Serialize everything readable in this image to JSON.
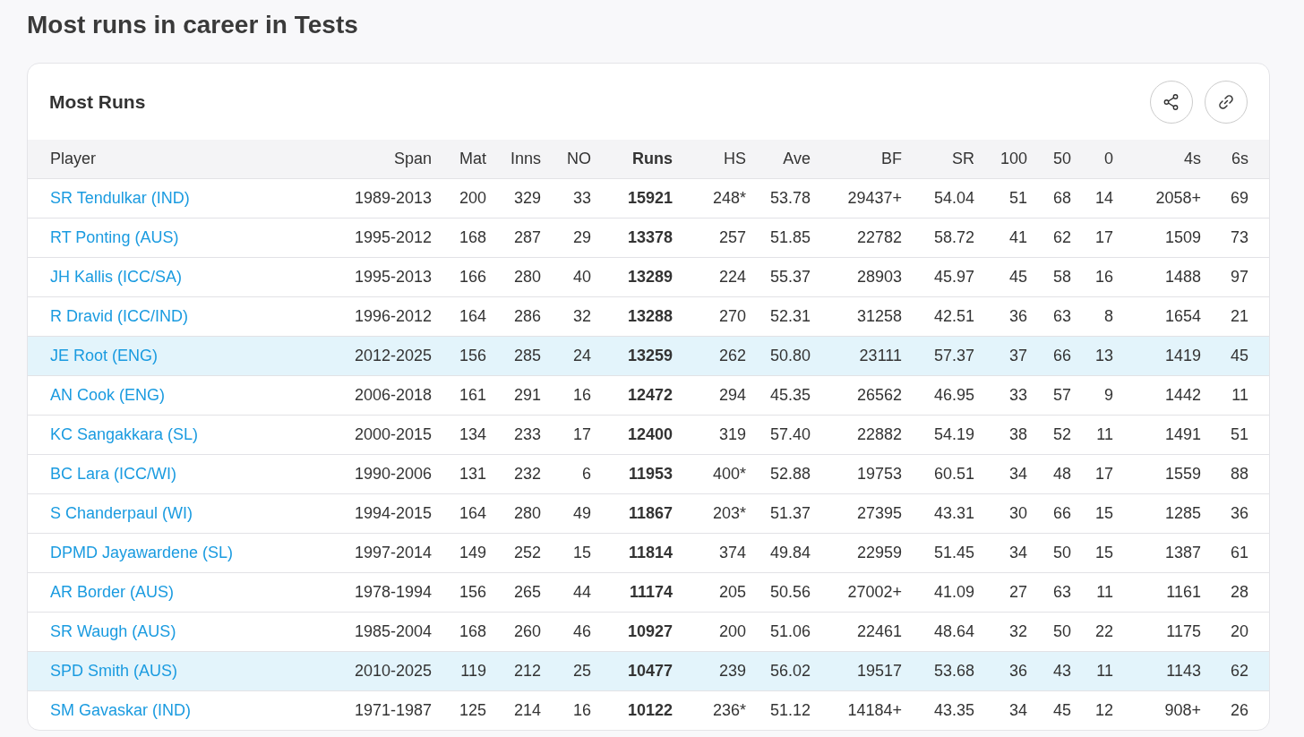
{
  "page_title": "Most runs in career in Tests",
  "card": {
    "title": "Most Runs"
  },
  "table": {
    "columns": [
      "Player",
      "Span",
      "Mat",
      "Inns",
      "NO",
      "Runs",
      "HS",
      "Ave",
      "BF",
      "SR",
      "100",
      "50",
      "0",
      "4s",
      "6s"
    ],
    "rows": [
      {
        "player": "SR Tendulkar (IND)",
        "highlighted": false,
        "values": [
          "1989-2013",
          "200",
          "329",
          "33",
          "15921",
          "248*",
          "53.78",
          "29437+",
          "54.04",
          "51",
          "68",
          "14",
          "2058+",
          "69"
        ]
      },
      {
        "player": "RT Ponting (AUS)",
        "highlighted": false,
        "values": [
          "1995-2012",
          "168",
          "287",
          "29",
          "13378",
          "257",
          "51.85",
          "22782",
          "58.72",
          "41",
          "62",
          "17",
          "1509",
          "73"
        ]
      },
      {
        "player": "JH Kallis (ICC/SA)",
        "highlighted": false,
        "values": [
          "1995-2013",
          "166",
          "280",
          "40",
          "13289",
          "224",
          "55.37",
          "28903",
          "45.97",
          "45",
          "58",
          "16",
          "1488",
          "97"
        ]
      },
      {
        "player": "R Dravid (ICC/IND)",
        "highlighted": false,
        "values": [
          "1996-2012",
          "164",
          "286",
          "32",
          "13288",
          "270",
          "52.31",
          "31258",
          "42.51",
          "36",
          "63",
          "8",
          "1654",
          "21"
        ]
      },
      {
        "player": "JE Root (ENG)",
        "highlighted": true,
        "values": [
          "2012-2025",
          "156",
          "285",
          "24",
          "13259",
          "262",
          "50.80",
          "23111",
          "57.37",
          "37",
          "66",
          "13",
          "1419",
          "45"
        ]
      },
      {
        "player": "AN Cook (ENG)",
        "highlighted": false,
        "values": [
          "2006-2018",
          "161",
          "291",
          "16",
          "12472",
          "294",
          "45.35",
          "26562",
          "46.95",
          "33",
          "57",
          "9",
          "1442",
          "11"
        ]
      },
      {
        "player": "KC Sangakkara (SL)",
        "highlighted": false,
        "values": [
          "2000-2015",
          "134",
          "233",
          "17",
          "12400",
          "319",
          "57.40",
          "22882",
          "54.19",
          "38",
          "52",
          "11",
          "1491",
          "51"
        ]
      },
      {
        "player": "BC Lara (ICC/WI)",
        "highlighted": false,
        "values": [
          "1990-2006",
          "131",
          "232",
          "6",
          "11953",
          "400*",
          "52.88",
          "19753",
          "60.51",
          "34",
          "48",
          "17",
          "1559",
          "88"
        ]
      },
      {
        "player": "S Chanderpaul (WI)",
        "highlighted": false,
        "values": [
          "1994-2015",
          "164",
          "280",
          "49",
          "11867",
          "203*",
          "51.37",
          "27395",
          "43.31",
          "30",
          "66",
          "15",
          "1285",
          "36"
        ]
      },
      {
        "player": "DPMD Jayawardene (SL)",
        "highlighted": false,
        "values": [
          "1997-2014",
          "149",
          "252",
          "15",
          "11814",
          "374",
          "49.84",
          "22959",
          "51.45",
          "34",
          "50",
          "15",
          "1387",
          "61"
        ]
      },
      {
        "player": "AR Border (AUS)",
        "highlighted": false,
        "values": [
          "1978-1994",
          "156",
          "265",
          "44",
          "11174",
          "205",
          "50.56",
          "27002+",
          "41.09",
          "27",
          "63",
          "11",
          "1161",
          "28"
        ]
      },
      {
        "player": "SR Waugh (AUS)",
        "highlighted": false,
        "values": [
          "1985-2004",
          "168",
          "260",
          "46",
          "10927",
          "200",
          "51.06",
          "22461",
          "48.64",
          "32",
          "50",
          "22",
          "1175",
          "20"
        ]
      },
      {
        "player": "SPD Smith (AUS)",
        "highlighted": true,
        "values": [
          "2010-2025",
          "119",
          "212",
          "25",
          "10477",
          "239",
          "56.02",
          "19517",
          "53.68",
          "36",
          "43",
          "11",
          "1143",
          "62"
        ]
      },
      {
        "player": "SM Gavaskar (IND)",
        "highlighted": false,
        "values": [
          "1971-1987",
          "125",
          "214",
          "16",
          "10122",
          "236*",
          "51.12",
          "14184+",
          "43.35",
          "34",
          "45",
          "12",
          "908+",
          "26"
        ]
      }
    ]
  }
}
